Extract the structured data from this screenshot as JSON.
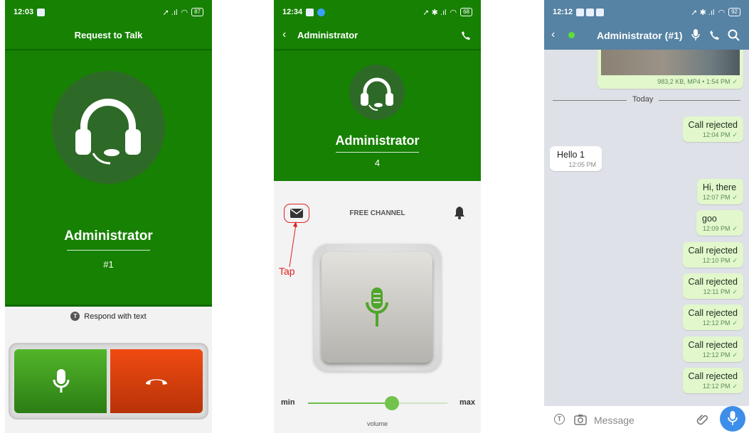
{
  "screen1": {
    "status_time": "12:03",
    "battery": "87",
    "title": "Request to Talk",
    "name": "Administrator",
    "number": "#1",
    "respond_icon_letter": "T",
    "respond_label": "Respond with text"
  },
  "screen2": {
    "status_time": "12:34",
    "battery": "68",
    "header_title": "Administrator",
    "name": "Administrator",
    "number": "4",
    "channel_label": "FREE CHANNEL",
    "tap_annotation": "Tap",
    "min_label": "min",
    "max_label": "max",
    "volume_label": "volume",
    "volume_level": 0.6
  },
  "screen3": {
    "status_time": "12:12",
    "battery": "92",
    "header_title": "Administrator (#1)",
    "video_meta": "983,2 KB, MP4 • 1:54 PM",
    "date_divider": "Today",
    "messages": [
      {
        "dir": "out",
        "text": "Call rejected",
        "time": "12:04 PM"
      },
      {
        "dir": "in",
        "text": "Hello 1",
        "time": "12:05 PM"
      },
      {
        "dir": "out",
        "text": "Hi, there",
        "time": "12:07 PM"
      },
      {
        "dir": "out",
        "text": "goo",
        "time": "12:09 PM"
      },
      {
        "dir": "out",
        "text": "Call rejected",
        "time": "12:10 PM"
      },
      {
        "dir": "out",
        "text": "Call rejected",
        "time": "12:11 PM"
      },
      {
        "dir": "out",
        "text": "Call rejected",
        "time": "12:12 PM"
      },
      {
        "dir": "out",
        "text": "Call rejected",
        "time": "12:12 PM"
      },
      {
        "dir": "out",
        "text": "Call rejected",
        "time": "12:12 PM"
      }
    ],
    "input_placeholder": "Message"
  },
  "colors": {
    "green": "#168102",
    "dark_circle": "#2e6a27",
    "accept_button": "#3da51a",
    "decline_button": "#e8430f",
    "chat_header": "#5682a3",
    "bubble_out": "#e2f7cb",
    "annotation_red": "#e02020"
  },
  "icons": [
    "headset-icon",
    "mic-icon",
    "hang-up-icon",
    "back-icon",
    "phone-icon",
    "mail-icon",
    "bell-icon",
    "search-icon",
    "camera-icon",
    "paperclip-icon",
    "text-icon",
    "check-icon"
  ]
}
